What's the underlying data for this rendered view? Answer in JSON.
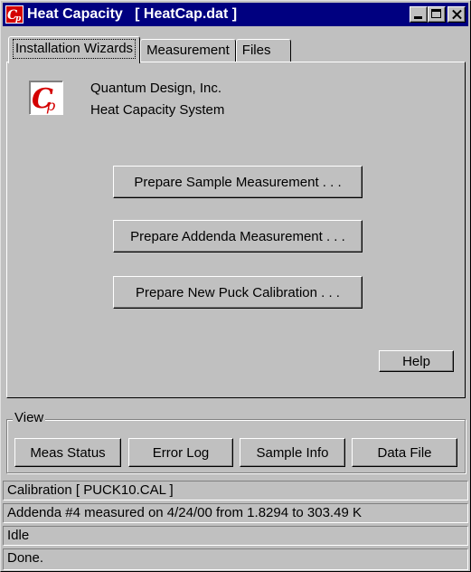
{
  "window": {
    "title": "Heat Capacity   [ HeatCap.dat ]",
    "icon": "cp-app-icon"
  },
  "tabs": [
    {
      "label": "Installation Wizards",
      "active": true
    },
    {
      "label": "Measurement",
      "active": false
    },
    {
      "label": "Files",
      "active": false
    }
  ],
  "company": {
    "line1": "Quantum Design, Inc.",
    "line2": "Heat Capacity System",
    "logo_text": "Cp",
    "logo_color": "#d40000"
  },
  "wizards": {
    "sample": "Prepare Sample Measurement . . .",
    "addenda": "Prepare Addenda Measurement . . .",
    "puck": "Prepare New Puck Calibration . . ."
  },
  "help_label": "Help",
  "view": {
    "label": "View",
    "buttons": [
      "Meas Status",
      "Error Log",
      "Sample Info",
      "Data File"
    ]
  },
  "status": {
    "calibration": "Calibration [ PUCK10.CAL ]",
    "addenda": "Addenda #4 measured on 4/24/00 from 1.8294 to 303.49 K",
    "state": "Idle",
    "message": "Done."
  },
  "colors": {
    "titlebar": "#000080",
    "face": "#c0c0c0"
  }
}
